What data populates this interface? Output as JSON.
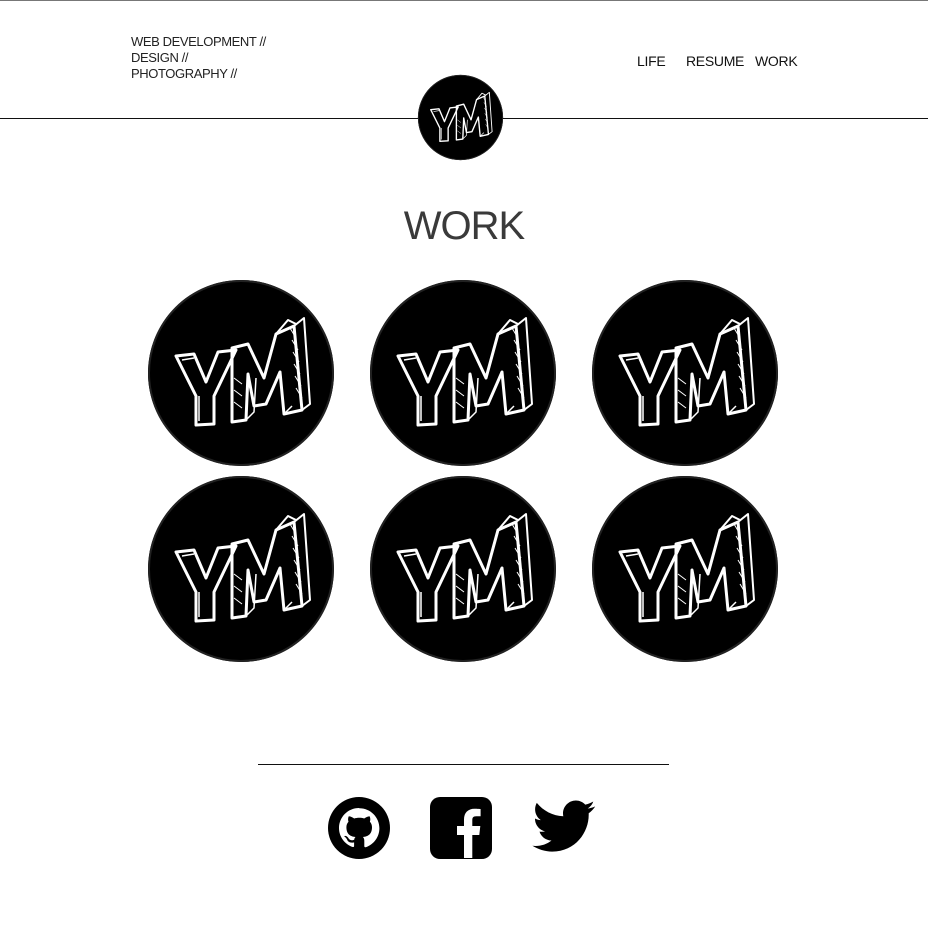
{
  "header": {
    "tagline": [
      "WEB DEVELOPMENT //",
      "DESIGN //",
      "PHOTOGRAPHY //"
    ],
    "logo_text": "YM",
    "nav": [
      {
        "label": "LIFE"
      },
      {
        "label": "RESUME"
      },
      {
        "label": "WORK"
      }
    ]
  },
  "main": {
    "title": "WORK",
    "tiles": [
      {
        "text": "YM"
      },
      {
        "text": "YM"
      },
      {
        "text": "YM"
      },
      {
        "text": "YM"
      },
      {
        "text": "YM"
      },
      {
        "text": "YM"
      }
    ]
  },
  "footer": {
    "social": [
      {
        "icon": "github-icon"
      },
      {
        "icon": "facebook-icon"
      },
      {
        "icon": "twitter-icon"
      }
    ]
  },
  "colors": {
    "text": "#111111",
    "title": "#3a3a3a",
    "logo_bg": "#000000",
    "logo_fg": "#ffffff"
  }
}
